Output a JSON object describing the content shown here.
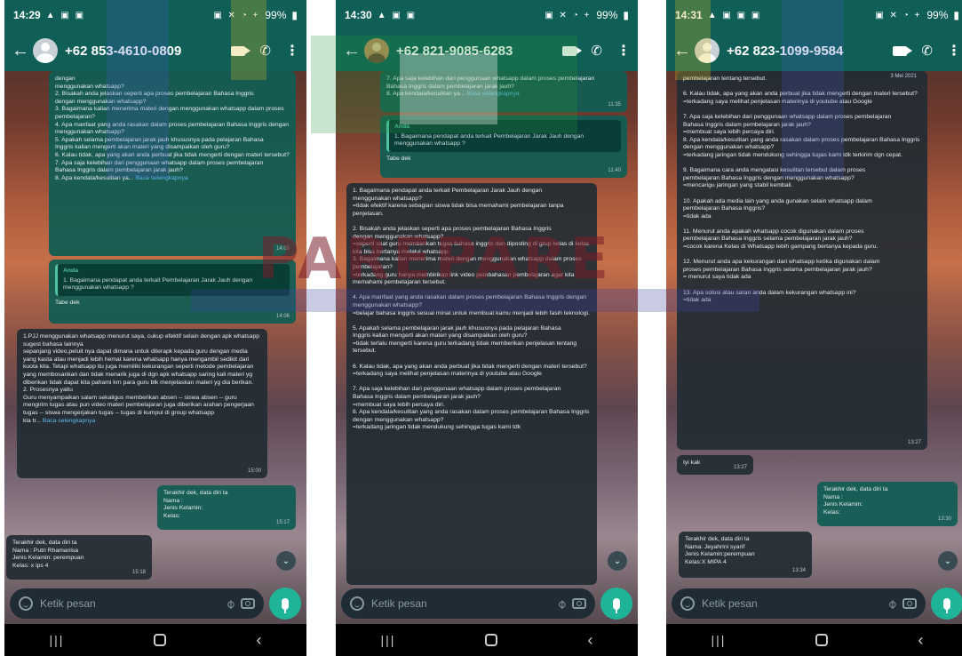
{
  "watermark": {
    "text": "PAREPARE"
  },
  "screens": [
    {
      "status": {
        "time": "14:29",
        "left_icons": "▲ ▣ ▣",
        "right_icons": "▣ ✕ ◔ +",
        "battery": "99%"
      },
      "contact": "+62 853-4610-0809",
      "messages": [
        {
          "text": "dengan\nmenggunakan whatsapp?\n2. Bisakah anda jelaskan seperti apa proses pembelajaran Bahasa Inggris\ndengan menggunakan whatsapp?\n3. Bagaimana kalian menerima materi dengan menggunakan whatsapp dalam  proses pembelajaran?\n4. Apa manfaat yang anda rasakan dalam proses pembelajaran Bahasa Inggris dengan menggunakan whatsapp?\n5. Apakah selama pembelajaran jarak jauh khususnya pada pelajaran Bahasa\nInggris kalian mengerti akan materi yang disampaikan oleh guru?\n6. Kalau tidak, apa yang akan anda perbuat jika tidak mengerti dengan materi tersebut?\n7. Apa saja kelebihan dari penggunaan whatsapp dalam proses pembelajaran\nBahasa Inggris dalam pembelajaran jarak jauh?\n8. Apa kendala/kesulitan ya...",
          "readmore": "Baca selengkapnya",
          "time": "14:05"
        },
        {
          "quote_name": "Anda",
          "quote": "1. Bagaimana pendapat anda terkait Pembelajaran Jarak Jauh dengan\nmenggunakan whatsapp ?",
          "text": "Tabe dek",
          "time": "14:06"
        },
        {
          "text": "1.PJJ menggunakan whatsapp menurut saya, cukup efektif selain dengan apk whatsapp sugest bahasa lainnya\nsepanjang video,peluit nya dapat dimana untuk diterapk kepada guru dengan media yang kasta atau menjadi lebih hemat karena whatsapp hanya mengambil sedikit dari kuota kita. Tetapi whatsapp itu juga memiliki kekurangan seperti metode pembelajaran yang membosankan dan tidak menarik juga di dgn apk whatsapp saring kali materi yg diberikan tidak dapat kita pahami krn para guru blk menjelaskan materi yg dia berikan.\n2. Prosesnya yaitu\nGuru menyampaikan salam sekaligus memberikan absen -- siswa absen -- guru mengirim tugas atau pun video materi pembelajaran juga diberikan arahan pengerjaan tugas -- siswa mengerjakan tugas -- tugas di kumpul di group whatsapp\nkla tr...",
          "readmore": "Baca selengkapnya",
          "time": "15:00"
        },
        {
          "text": "Terakhir dek, data diri ta\nNama :\nJenis Kelamin:\nKelas:",
          "time": "15:17"
        },
        {
          "text": "Terakhir dek, data diri ta\nNama : Putri Rhamanisa\nJenis Kelamin: perempuan\nKelas: x ips 4",
          "time": "15:18"
        }
      ],
      "input_placeholder": "Ketik pesan"
    },
    {
      "status": {
        "time": "14:30",
        "left_icons": "▲ ▣ ▣",
        "right_icons": "▣ ✕ ◔ +",
        "battery": "99%"
      },
      "contact": "+62 821-9085-6283",
      "messages": [
        {
          "text": "7. Apa saja kelebihan dari penggunaan whatsapp dalam proses pembelajaran\nBahasa Inggris dalam pembelajaran jarak jauh?\n8. Apa kendala/kesulitan ya...",
          "readmore": "Baca selengkapnya",
          "time": "11:35"
        },
        {
          "quote_name": "Anda",
          "quote": "1. Bagaimana pendapat anda terkait Pembelajaran Jarak Jauh dengan\nmenggunakan whatsapp ?",
          "text": "Tabe dek",
          "time": "11:40"
        },
        {
          "text": "1. Bagaimana pendapat anda terkait Pembelajaran Jarak Jauh dengan\nmenggunakan whatsapp?\n=tidak efektif karena sebagian siswa tidak bisa memahami pembelajaran tanpa penjelasan.\n\n2. Bisakah anda jelaskan seperti apa proses pembelajaran Bahasa Inggris\ndengan menggunakan whatsapp?\n=seperti saat guru memberikan tugas bahasa inggris dan diposting di grup kelas di kelas kita bisa bertanya melalui whatsapp\n3. Bagaimana kalian menerima materi dengan menggunakan whatsapp dalam proses pembelajaran?\n=terkadang guru hanya membirikan link video pembahasan pembelajaran agar kita memahami pembelajaran tersebut.\n\n4. Apa manfaat yang anda rasakan dalam proses pembelajaran Bahasa Inggris dengan menggunakan whatsapp?\n=belajar bahasa inggris sesuai minat untuk membuat kamu menjadi lebih fasih teknologi.\n\n5. Apakah selama pembelajaran jarak jauh khususnya pada pelajaran Bahasa\nInggris kalian mengerti akan materi yang disampaikan oleh guru?\n=tidak terlalu mengerti karena guru terkadang tidak memberikan penjelasan tentang tersebut.\n\n6. Kalau tidak, apa yang akan anda perbuat jika tidak mengerti dengan materi tersebut?\n=terkadang saya melihat penjelasan materinya di youtube atau Google\n\n7. Apa saja kelebihan dari penggunaan whatsapp dalam proses pembelajaran\nBahasa Inggris dalam pembelajaran jarak jauh?\n=membuat saya lebih percaya diri.\n8. Apa kendala/kesulitan yang anda rasakan dalam proses pembelajaran Bahasa Inggris dengan menggunakan whatsapp?\n=terkadang jaringan tidak mendukung sehingga tugas kami tdk",
          "time": ""
        }
      ],
      "input_placeholder": "Ketik pesan"
    },
    {
      "status": {
        "time": "14:31",
        "left_icons": "▲ ▣ ▣ ▣",
        "right_icons": "▣ ✕ ◔ +",
        "battery": "99%"
      },
      "contact": "+62 823-1099-9584",
      "messages": [
        {
          "text": "pembelajaran tentang tersebut.\n\n6. Kalau tidak, apa yang akan anda perbuat jika tidak mengerti dengan materi tersebut?\n=terkadang saya melihat penjelasan materinya di youtube atau Google\n\n7. Apa saja kelebihan dari penggunaan whatsapp dalam proses pembelajaran\nBahasa Inggris dalam pembelajaran jarak jauh?\n=membuat saya lebih percaya diri.\n8. Apa kendala/kesulitan yang anda rasakan dalam proses pembelajaran Bahasa Inggris dengan menggunakan whatsapp?\n=terkadang jaringan tidak mendukung sehingga tugas kami tdk terkirim dgn cepat.\n\n9. Bagaimana cara anda mengatasi kesulitan tersebut dalam proses\npembelajaran Bahasa Inggris dengan menggunakan whatsapp?\n=mencarigu jaringan yang stabil kembali.\n\n10. Apakah ada media lain yang anda gunakan selain whatsapp dalam\npembelajaran Bahasa Inggris?\n=tidak ada\n\n11. Menurut anda apakah whatsapp cocok digunakan dalam proses\npembelajaran Bahasa Inggris selama pembelajaran jarak jauh?\n=cocok karena Kelas di Whatsapp lebih gampang bertanya kepada guru.\n\n12. Menurut anda apa kekurangan dari whatsapp ketika digunakan dalam\nproses pembelajaran Bahasa Inggris selama pembelajaran jarak jauh?\n= menurut saya tidak ada\n\n13. Apa solusi atau saran anda dalam kekurangan whatsapp ini?\n=tidak ada",
          "time": "13:27",
          "date": "3 Mei 2021"
        },
        {
          "text": "Iyi kak",
          "time": "13:27"
        },
        {
          "text": "Terakhir dek, data diri ta\nNama :\nJenis Kelamin:\nKelas:",
          "time": "13:30"
        },
        {
          "text": "Terakhir dek, data diri ta\nNama: Jeyahrini syarif\nJenis Kelamin:perempuan\nKelas:X MIPA 4",
          "time": "13:34"
        }
      ],
      "input_placeholder": "Ketik pesan"
    }
  ]
}
